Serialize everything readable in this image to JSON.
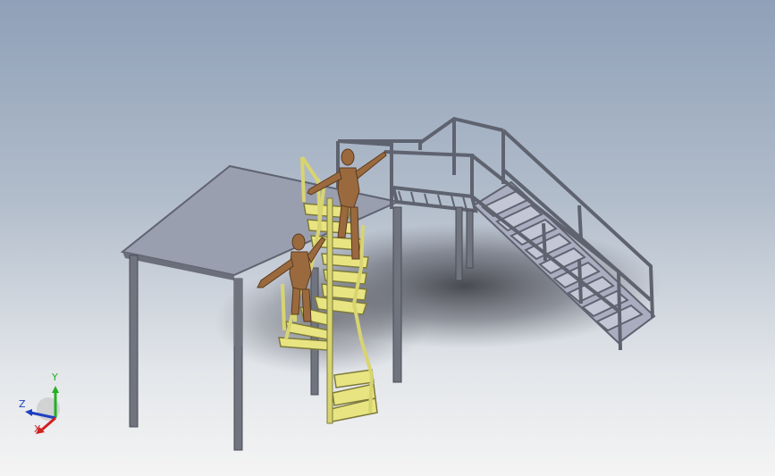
{
  "viewport": {
    "background_top": "#8fa0b8",
    "background_bottom": "#f4f4f4"
  },
  "model": {
    "frame_color": "#5f6370",
    "platform_color": "#9a9fb0",
    "stair_color": "#e8e482",
    "figure_color": "#9a6a3e"
  },
  "triad": {
    "x_label": "X",
    "y_label": "Y",
    "z_label": "Z",
    "x_color": "#d02020",
    "y_color": "#22b022",
    "z_color": "#2040c0"
  }
}
